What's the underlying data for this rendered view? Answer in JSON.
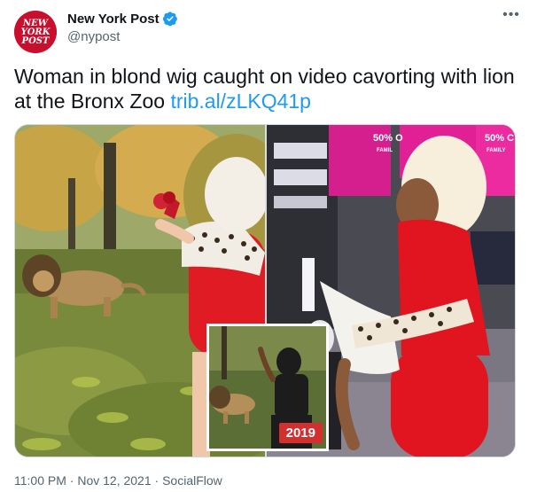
{
  "account": {
    "display_name": "New York Post",
    "handle": "@nypost",
    "avatar_text_1": "NEW",
    "avatar_text_2": "YORK",
    "avatar_text_3": "POST",
    "verified": true
  },
  "tweet": {
    "text": "Woman in blond wig caught on video cavorting with lion at the Bronx Zoo ",
    "link": "trib.al/zLKQ41p"
  },
  "media": {
    "sign_left": "50% O",
    "sign_left_sub": "FAMIL",
    "sign_right": "50% C",
    "sign_right_sub": "FAMILY",
    "inset_badge": "2019"
  },
  "meta": {
    "time": "11:00 PM",
    "date": "Nov 12, 2021",
    "separator": "·",
    "source": "SocialFlow"
  },
  "colors": {
    "brand_red": "#c8102e",
    "link_blue": "#1d9bf0",
    "muted": "#536471"
  }
}
